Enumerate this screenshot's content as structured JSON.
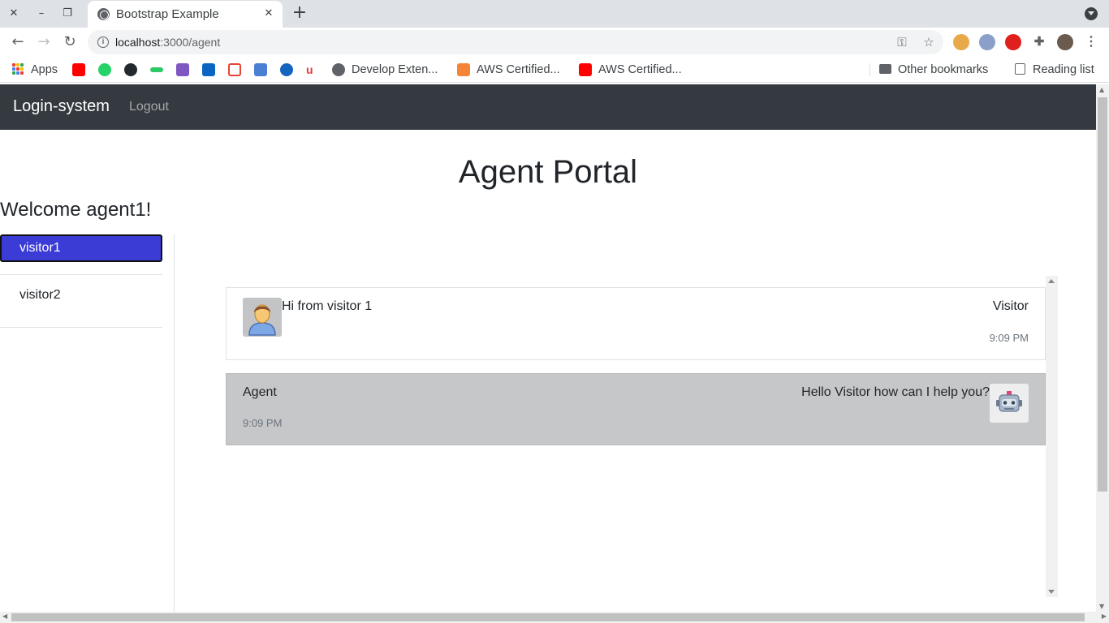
{
  "browser": {
    "tab_title": "Bootstrap Example",
    "url_host": "localhost",
    "url_path": ":3000/agent",
    "bookmarks": {
      "apps": "Apps",
      "develop": "Develop Exten...",
      "aws1": "AWS Certified...",
      "aws2": "AWS Certified...",
      "other": "Other bookmarks",
      "reading": "Reading list"
    }
  },
  "navbar": {
    "brand": "Login-system",
    "logout": "Logout"
  },
  "main": {
    "title": "Agent Portal",
    "welcome": "Welcome agent1!"
  },
  "visitors": [
    {
      "label": "visitor1",
      "active": true
    },
    {
      "label": "visitor2",
      "active": false
    }
  ],
  "messages": [
    {
      "sender": "Visitor",
      "text": "Hi from visitor 1",
      "time": "9:09 PM",
      "avatar": "person-avatar-icon"
    },
    {
      "sender": "Agent",
      "text": "Hello Visitor how can I help you?",
      "time": "9:09 PM",
      "avatar": "robot-avatar-icon"
    }
  ],
  "colors": {
    "navbar_bg": "#343a40",
    "active_visitor": "#3b3bd6",
    "agent_message_bg": "#c6c7c9"
  }
}
